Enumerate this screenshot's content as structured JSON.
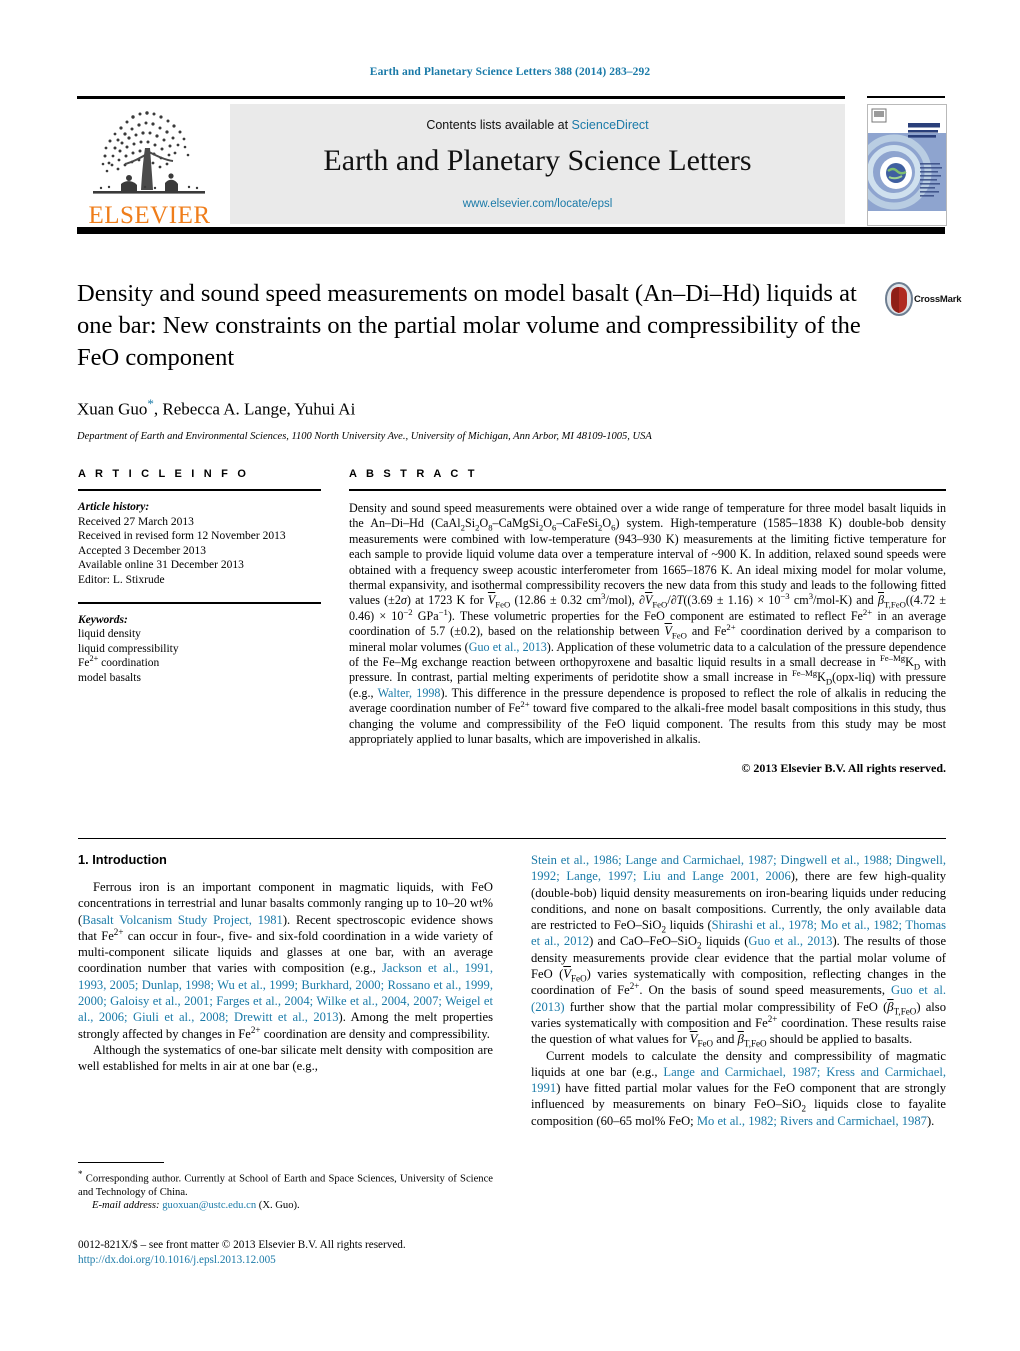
{
  "running_head": "Earth and Planetary Science Letters 388 (2014) 283–292",
  "masthead": {
    "contents_prefix": "Contents lists available at ",
    "sciencedirect": "ScienceDirect",
    "journal_title": "Earth and Planetary Science Letters",
    "journal_url": "www.elsevier.com/locate/epsl",
    "publisher_logo_text": "ELSEVIER",
    "cover_title_line1": "EARTH",
    "cover_title_line2": "AND PLANETARY",
    "cover_title_line3": "SCIENCE LETTERS"
  },
  "crossmark": {
    "label": "CrossMark"
  },
  "article": {
    "title": "Density and sound speed measurements on model basalt (An–Di–Hd) liquids at one bar: New constraints on the partial molar volume and compressibility of the FeO component",
    "authors": "Xuan Guo",
    "authors_rest": ", Rebecca A. Lange, Yuhui Ai",
    "corresponding_marker": "*",
    "affiliation": "Department of Earth and Environmental Sciences, 1100 North University Ave., University of Michigan, Ann Arbor, MI 48109-1005, USA"
  },
  "info": {
    "heading": "A R T I C L E   I N F O",
    "history_label": "Article history:",
    "history": [
      "Received 27 March 2013",
      "Received in revised form 12 November 2013",
      "Accepted 3 December 2013",
      "Available online 31 December 2013",
      "Editor: L. Stixrude"
    ],
    "keywords_label": "Keywords:",
    "keywords": [
      "liquid density",
      "liquid compressibility",
      "Fe2+ coordination",
      "model basalts"
    ]
  },
  "abstract": {
    "heading": "A B S T R A C T",
    "copyright": "© 2013 Elsevier B.V. All rights reserved."
  },
  "introduction": {
    "heading": "1. Introduction"
  },
  "footnote": {
    "corresponding": "Corresponding author. Currently at School of Earth and Space Sciences, University of Science and Technology of China.",
    "email_label": "E-mail address:",
    "email": "guoxuan@ustc.edu.cn",
    "email_suffix": "(X. Guo)."
  },
  "imprint": {
    "issn_line": "0012-821X/$ – see front matter © 2013 Elsevier B.V. All rights reserved.",
    "doi": "http://dx.doi.org/10.1016/j.epsl.2013.12.005"
  },
  "colors": {
    "link": "#1a7aa8",
    "elsevier_orange": "#ef7d1a",
    "masthead_grey": "#eaeaea"
  }
}
